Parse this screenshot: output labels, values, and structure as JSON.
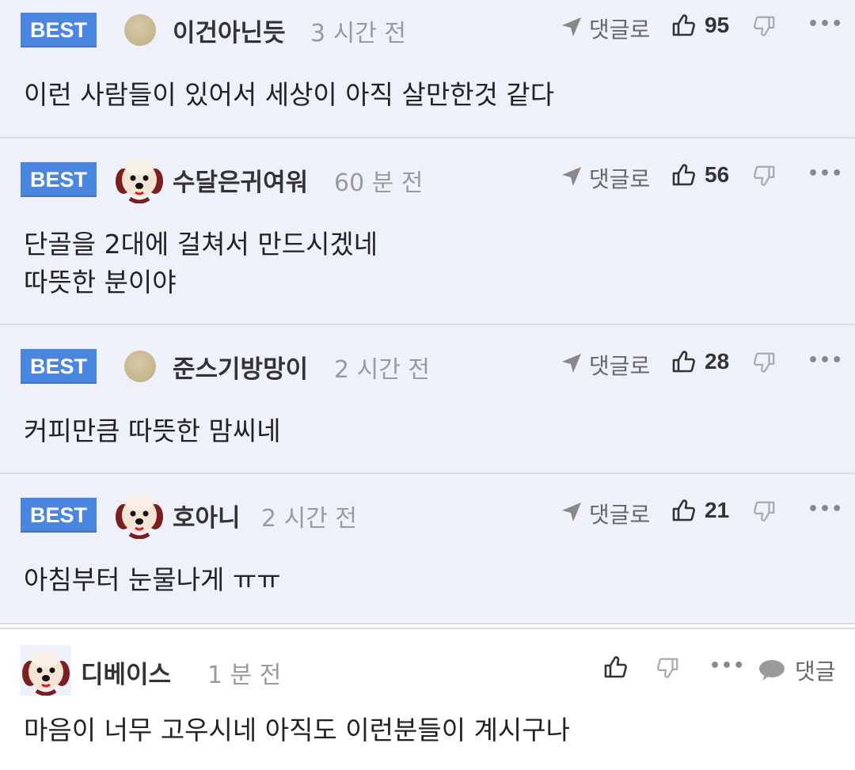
{
  "best_comments": [
    {
      "badge": "BEST",
      "avatar": "default-circle",
      "nickname": "이건아닌듯",
      "time": "3 시간 전",
      "reply_label": "댓글로",
      "likes": "95",
      "text": [
        "이런 사람들이 있어서 세상이 아직 살만한것 같다"
      ]
    },
    {
      "badge": "BEST",
      "avatar": "dog",
      "nickname": "수달은귀여워",
      "time": "60 분 전",
      "reply_label": "댓글로",
      "likes": "56",
      "text": [
        "단골을 2대에 걸쳐서 만드시겠네",
        "따뜻한 분이야"
      ]
    },
    {
      "badge": "BEST",
      "avatar": "default-circle",
      "nickname": "준스기방망이",
      "time": "2 시간 전",
      "reply_label": "댓글로",
      "likes": "28",
      "text": [
        "커피만큼 따뜻한 맘씨네"
      ]
    },
    {
      "badge": "BEST",
      "avatar": "dog",
      "nickname": "호아니",
      "time": "2 시간 전",
      "reply_label": "댓글로",
      "likes": "21",
      "text": [
        "아침부터 눈물나게 ㅠㅠ"
      ]
    }
  ],
  "latest_comment": {
    "avatar": "dog",
    "nickname": "디베이스",
    "time": "1 분 전",
    "reply_label": "댓글",
    "text": "마음이 너무 고우시네 아직도 이런분들이 계시구나"
  },
  "icons": {
    "like": "thumbs-up-icon",
    "dislike": "thumbs-down-icon",
    "reply": "arrow-reply-icon",
    "more": "more-dots-icon",
    "speech": "speech-bubble-icon"
  },
  "colors": {
    "best_badge": "#4a86e0",
    "best_bg": "#eef1f9",
    "time": "#9a9a9a"
  }
}
